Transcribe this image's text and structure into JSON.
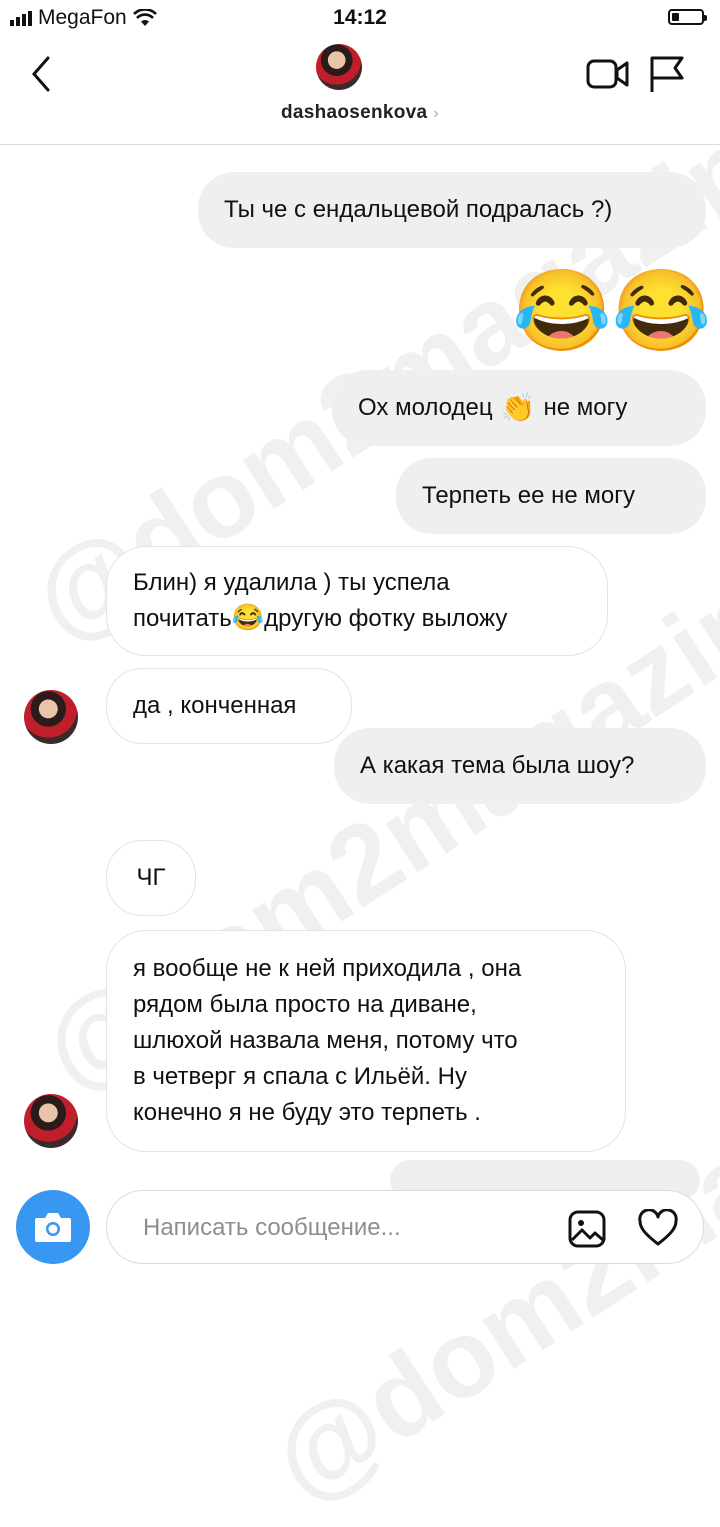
{
  "status_bar": {
    "carrier": "MegaFon",
    "time": "14:12",
    "battery_level": 0.25
  },
  "header": {
    "username": "dashaosenkova",
    "chevron": "›",
    "icons": [
      "back-icon",
      "video-call-icon",
      "flag-icon"
    ]
  },
  "messages": [
    {
      "side": "outgoing",
      "text": "Ты че с ендальцевой подралась ?)"
    },
    {
      "side": "outgoing",
      "emoji": "😂😂"
    },
    {
      "side": "outgoing",
      "text_a": "Ох молодец",
      "emoji": "👏",
      "text_b": "не могу"
    },
    {
      "side": "outgoing",
      "text": "Терпеть ее не могу"
    },
    {
      "side": "incoming",
      "line1": "Блин) я удалила ) ты успела",
      "line2_a": "почитать",
      "emoji": "😂",
      "line2_b": "другую фотку выложу"
    },
    {
      "side": "incoming",
      "text": "да , конченная"
    },
    {
      "side": "outgoing",
      "text": "А какая тема была шоу?"
    },
    {
      "side": "incoming",
      "text": "ЧГ"
    },
    {
      "side": "incoming",
      "lines": [
        "я вообще не к ней приходила , она",
        "рядом была просто на диване,",
        "шлюхой назвала меня, потому что",
        "в четверг я спала с Ильёй. Ну",
        "конечно я не буду это терпеть ."
      ]
    }
  ],
  "composer": {
    "placeholder": "Написать сообщение...",
    "icons": [
      "camera-icon",
      "gallery-icon",
      "heart-icon"
    ]
  },
  "watermark": "@dom2magazine",
  "colors": {
    "accent": "#3897f0",
    "outgoing_bubble": "#efefef",
    "incoming_border": "#e3e3e3"
  }
}
